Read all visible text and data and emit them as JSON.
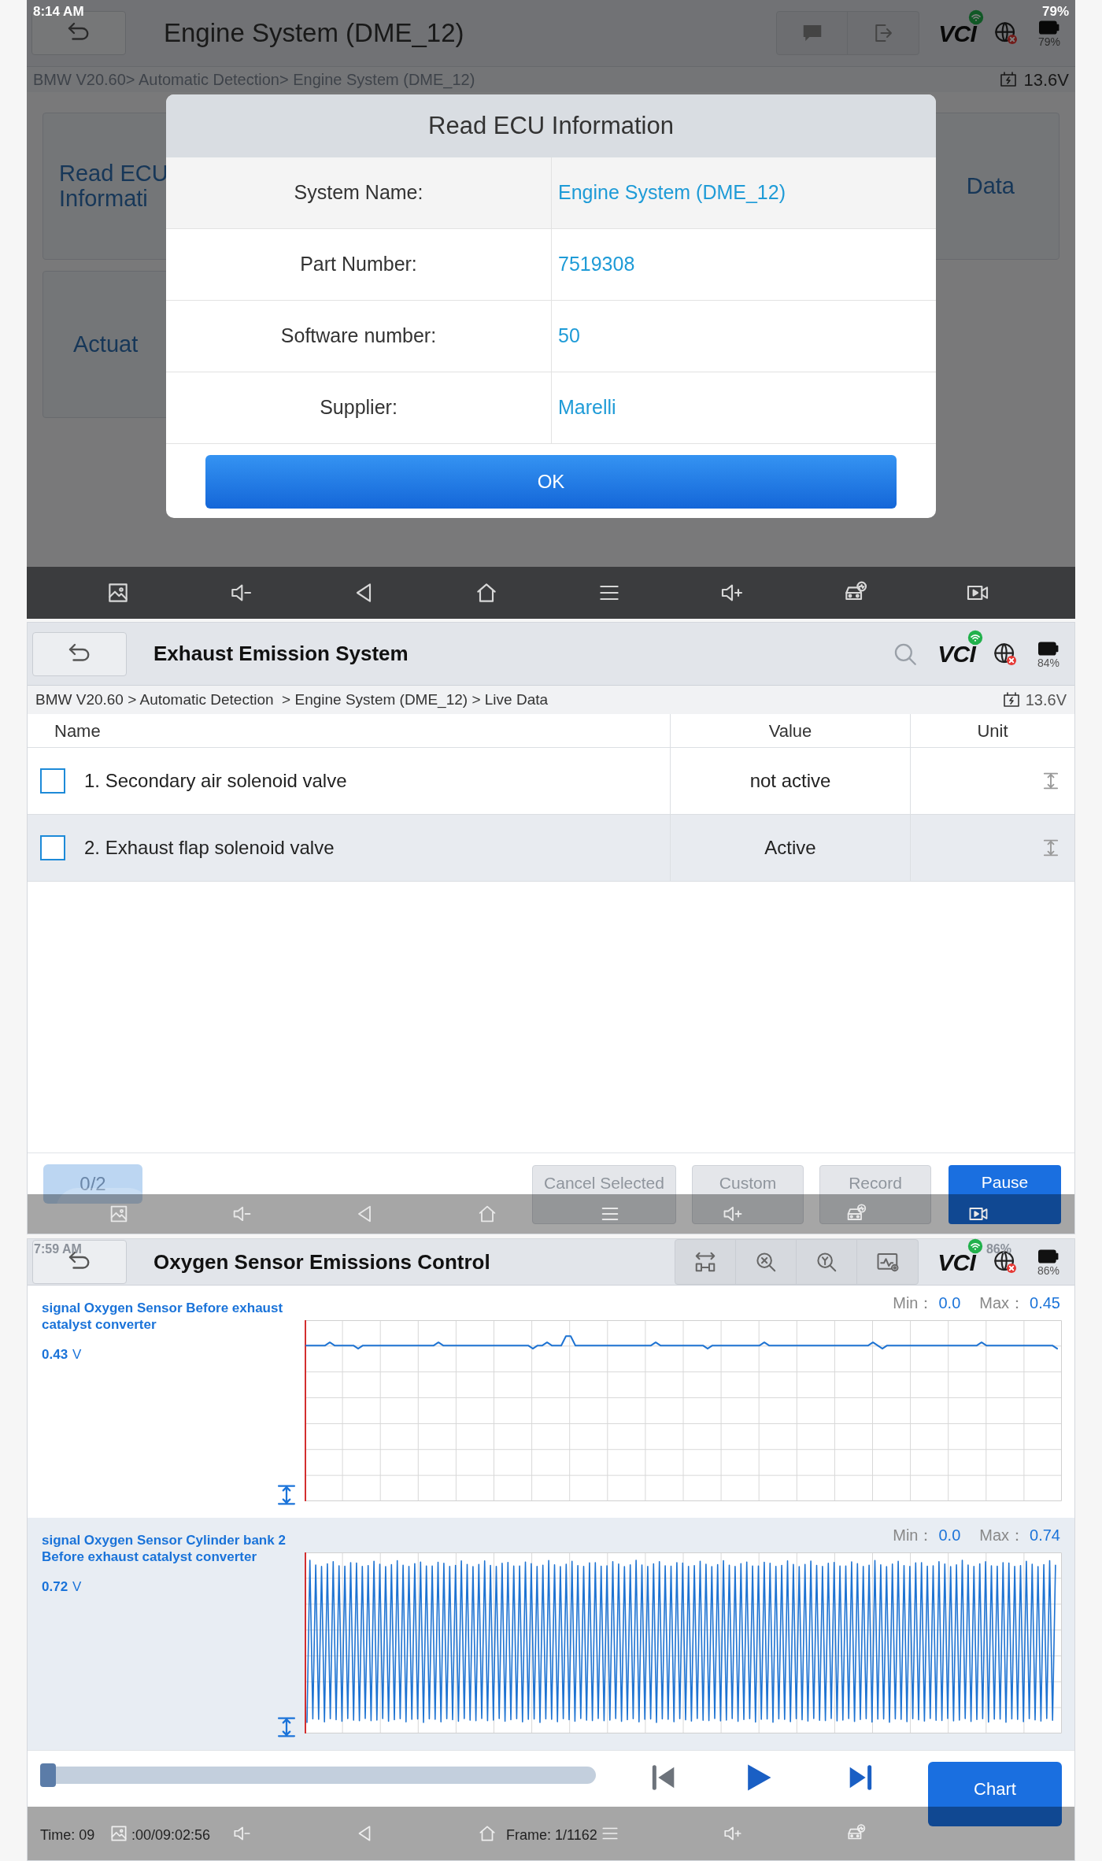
{
  "ecu_screen": {
    "status_bar": {
      "time": "8:14 AM",
      "battery": "79%"
    },
    "title": "Engine System (DME_12)",
    "vci_label": "VCI",
    "battery_label": "79%",
    "breadcrumb": "BMW V20.60> Automatic Detection> Engine System (DME_12)",
    "voltage": "13.6V",
    "tiles": [
      {
        "label": "Read ECU Informati"
      },
      {
        "label": "Data"
      },
      {
        "label": "Actuat"
      }
    ],
    "dialog": {
      "title": "Read ECU Information",
      "rows": [
        {
          "label": "System Name:",
          "value": "Engine System (DME_12)"
        },
        {
          "label": "Part Number:",
          "value": "7519308"
        },
        {
          "label": "Software number:",
          "value": "50"
        },
        {
          "label": "Supplier:",
          "value": "Marelli"
        }
      ],
      "button": "OK"
    }
  },
  "live_data_screen": {
    "title": "Exhaust Emission System",
    "vci_label": "VCI",
    "battery_label": "84%",
    "breadcrumb": "BMW V20.60 > Automatic Detection  > Engine System (DME_12) > Live Data",
    "voltage": "13.6V",
    "columns": [
      "Name",
      "Value",
      "Unit"
    ],
    "rows": [
      {
        "name": "1. Secondary air solenoid valve",
        "value": "not active",
        "checked": false
      },
      {
        "name": "2. Exhaust flap solenoid valve",
        "value": "Active",
        "checked": false
      }
    ],
    "counter": "0/2",
    "buttons": [
      {
        "label": "Cancel Selected",
        "primary": false
      },
      {
        "label": "Custom",
        "primary": false
      },
      {
        "label": "Record",
        "primary": false
      },
      {
        "label": "Pause",
        "primary": true
      }
    ]
  },
  "sensor_screen": {
    "status_bar": {
      "time": "7:59 AM",
      "battery": "86%"
    },
    "title": "Oxygen Sensor Emissions Control",
    "vci_label": "VCI",
    "battery_label": "86%",
    "channels": [
      {
        "label": "signal Oxygen Sensor Before exhaust catalyst converter",
        "reading": "0.43",
        "unit": "V",
        "min_label": "Min：",
        "min": "0.0",
        "max_label": "Max：",
        "max": "0.45",
        "kind": "flat"
      },
      {
        "label": "signal Oxygen Sensor Cylinder bank 2 Before exhaust catalyst converter",
        "reading": "0.72",
        "unit": "V",
        "min_label": "Min：",
        "min": "0.0",
        "max_label": "Max：",
        "max": "0.74",
        "kind": "oscillating"
      }
    ],
    "playback": {
      "level": 0,
      "time_start": "Time: 09",
      "time_end": ":00/09:02:56",
      "frame": "Frame: 1/1162",
      "chart_button": "Chart"
    }
  }
}
